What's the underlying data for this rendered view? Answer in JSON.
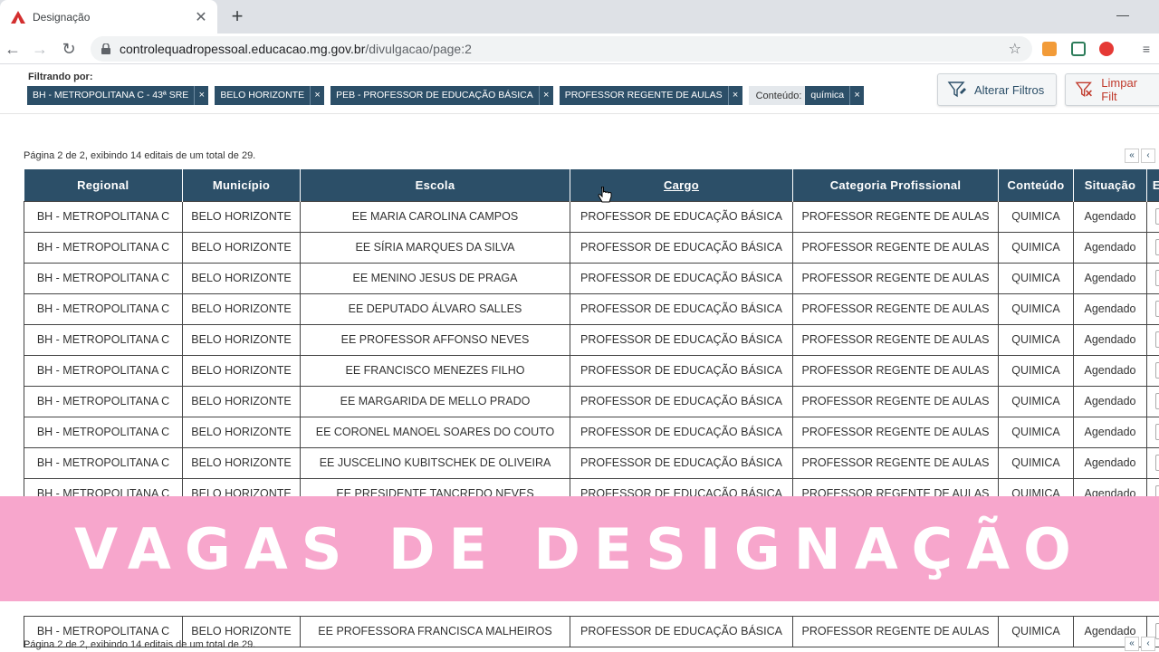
{
  "browser": {
    "tab_title": "Designação",
    "url_host": "controlequadropessoal.educacao.mg.gov.br",
    "url_path": "/divulgacao/page:2"
  },
  "filters": {
    "label": "Filtrando por:",
    "chips": [
      "BH - METROPOLITANA C - 43ª SRE",
      "BELO HORIZONTE",
      "PEB - PROFESSOR DE EDUCAÇÃO BÁSICA",
      "PROFESSOR REGENTE DE AULAS"
    ],
    "content_label": "Conteúdo:",
    "content_value": "química",
    "alter_button": "Alterar Filtros",
    "clear_button": "Limpar Filt"
  },
  "pagination": {
    "info_top": "Página 2 de 2, exibindo 14 editais de um total de 29.",
    "info_bottom": "Página 2 de 2, exibindo 14 editais de um total de 29.",
    "first": "«",
    "prev": "‹"
  },
  "table": {
    "headers": [
      "Regional",
      "Município",
      "Escola",
      "Cargo",
      "Categoria Profissional",
      "Conteúdo",
      "Situação",
      "Ed"
    ],
    "rows": [
      [
        "BH - METROPOLITANA C",
        "BELO HORIZONTE",
        "EE MARIA CAROLINA CAMPOS",
        "PROFESSOR DE EDUCAÇÃO BÁSICA",
        "PROFESSOR REGENTE DE AULAS",
        "QUIMICA",
        "Agendado"
      ],
      [
        "BH - METROPOLITANA C",
        "BELO HORIZONTE",
        "EE SÍRIA MARQUES DA SILVA",
        "PROFESSOR DE EDUCAÇÃO BÁSICA",
        "PROFESSOR REGENTE DE AULAS",
        "QUIMICA",
        "Agendado"
      ],
      [
        "BH - METROPOLITANA C",
        "BELO HORIZONTE",
        "EE MENINO JESUS DE PRAGA",
        "PROFESSOR DE EDUCAÇÃO BÁSICA",
        "PROFESSOR REGENTE DE AULAS",
        "QUIMICA",
        "Agendado"
      ],
      [
        "BH - METROPOLITANA C",
        "BELO HORIZONTE",
        "EE DEPUTADO ÁLVARO SALLES",
        "PROFESSOR DE EDUCAÇÃO BÁSICA",
        "PROFESSOR REGENTE DE AULAS",
        "QUIMICA",
        "Agendado"
      ],
      [
        "BH - METROPOLITANA C",
        "BELO HORIZONTE",
        "EE PROFESSOR AFFONSO NEVES",
        "PROFESSOR DE EDUCAÇÃO BÁSICA",
        "PROFESSOR REGENTE DE AULAS",
        "QUIMICA",
        "Agendado"
      ],
      [
        "BH - METROPOLITANA C",
        "BELO HORIZONTE",
        "EE FRANCISCO MENEZES FILHO",
        "PROFESSOR DE EDUCAÇÃO BÁSICA",
        "PROFESSOR REGENTE DE AULAS",
        "QUIMICA",
        "Agendado"
      ],
      [
        "BH - METROPOLITANA C",
        "BELO HORIZONTE",
        "EE MARGARIDA DE MELLO PRADO",
        "PROFESSOR DE EDUCAÇÃO BÁSICA",
        "PROFESSOR REGENTE DE AULAS",
        "QUIMICA",
        "Agendado"
      ],
      [
        "BH - METROPOLITANA C",
        "BELO HORIZONTE",
        "EE CORONEL MANOEL SOARES DO COUTO",
        "PROFESSOR DE EDUCAÇÃO BÁSICA",
        "PROFESSOR REGENTE DE AULAS",
        "QUIMICA",
        "Agendado"
      ],
      [
        "BH - METROPOLITANA C",
        "BELO HORIZONTE",
        "EE JUSCELINO KUBITSCHEK DE OLIVEIRA",
        "PROFESSOR DE EDUCAÇÃO BÁSICA",
        "PROFESSOR REGENTE DE AULAS",
        "QUIMICA",
        "Agendado"
      ],
      [
        "BH - METROPOLITANA C",
        "BELO HORIZONTE",
        "EE PRESIDENTE TANCREDO NEVES",
        "PROFESSOR DE EDUCAÇÃO BÁSICA",
        "PROFESSOR REGENTE DE AULAS",
        "QUIMICA",
        "Agendado"
      ]
    ],
    "last_row": [
      "BH - METROPOLITANA C",
      "BELO HORIZONTE",
      "EE PROFESSORA FRANCISCA MALHEIROS",
      "PROFESSOR DE EDUCAÇÃO BÁSICA",
      "PROFESSOR REGENTE DE AULAS",
      "QUIMICA",
      "Agendado"
    ]
  },
  "banner": {
    "text": "VAGAS DE DESIGNAÇÃO"
  },
  "colors": {
    "header": "#2c4f68",
    "banner": "#f7a6cc",
    "clear": "#c0392b"
  }
}
